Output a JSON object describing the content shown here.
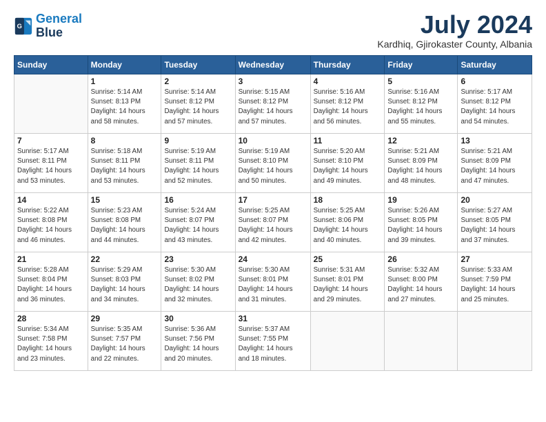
{
  "logo": {
    "line1": "General",
    "line2": "Blue"
  },
  "title": "July 2024",
  "location": "Kardhiq, Gjirokaster County, Albania",
  "weekdays": [
    "Sunday",
    "Monday",
    "Tuesday",
    "Wednesday",
    "Thursday",
    "Friday",
    "Saturday"
  ],
  "weeks": [
    [
      {
        "day": "",
        "info": ""
      },
      {
        "day": "1",
        "info": "Sunrise: 5:14 AM\nSunset: 8:13 PM\nDaylight: 14 hours\nand 58 minutes."
      },
      {
        "day": "2",
        "info": "Sunrise: 5:14 AM\nSunset: 8:12 PM\nDaylight: 14 hours\nand 57 minutes."
      },
      {
        "day": "3",
        "info": "Sunrise: 5:15 AM\nSunset: 8:12 PM\nDaylight: 14 hours\nand 57 minutes."
      },
      {
        "day": "4",
        "info": "Sunrise: 5:16 AM\nSunset: 8:12 PM\nDaylight: 14 hours\nand 56 minutes."
      },
      {
        "day": "5",
        "info": "Sunrise: 5:16 AM\nSunset: 8:12 PM\nDaylight: 14 hours\nand 55 minutes."
      },
      {
        "day": "6",
        "info": "Sunrise: 5:17 AM\nSunset: 8:12 PM\nDaylight: 14 hours\nand 54 minutes."
      }
    ],
    [
      {
        "day": "7",
        "info": "Sunrise: 5:17 AM\nSunset: 8:11 PM\nDaylight: 14 hours\nand 53 minutes."
      },
      {
        "day": "8",
        "info": "Sunrise: 5:18 AM\nSunset: 8:11 PM\nDaylight: 14 hours\nand 53 minutes."
      },
      {
        "day": "9",
        "info": "Sunrise: 5:19 AM\nSunset: 8:11 PM\nDaylight: 14 hours\nand 52 minutes."
      },
      {
        "day": "10",
        "info": "Sunrise: 5:19 AM\nSunset: 8:10 PM\nDaylight: 14 hours\nand 50 minutes."
      },
      {
        "day": "11",
        "info": "Sunrise: 5:20 AM\nSunset: 8:10 PM\nDaylight: 14 hours\nand 49 minutes."
      },
      {
        "day": "12",
        "info": "Sunrise: 5:21 AM\nSunset: 8:09 PM\nDaylight: 14 hours\nand 48 minutes."
      },
      {
        "day": "13",
        "info": "Sunrise: 5:21 AM\nSunset: 8:09 PM\nDaylight: 14 hours\nand 47 minutes."
      }
    ],
    [
      {
        "day": "14",
        "info": "Sunrise: 5:22 AM\nSunset: 8:08 PM\nDaylight: 14 hours\nand 46 minutes."
      },
      {
        "day": "15",
        "info": "Sunrise: 5:23 AM\nSunset: 8:08 PM\nDaylight: 14 hours\nand 44 minutes."
      },
      {
        "day": "16",
        "info": "Sunrise: 5:24 AM\nSunset: 8:07 PM\nDaylight: 14 hours\nand 43 minutes."
      },
      {
        "day": "17",
        "info": "Sunrise: 5:25 AM\nSunset: 8:07 PM\nDaylight: 14 hours\nand 42 minutes."
      },
      {
        "day": "18",
        "info": "Sunrise: 5:25 AM\nSunset: 8:06 PM\nDaylight: 14 hours\nand 40 minutes."
      },
      {
        "day": "19",
        "info": "Sunrise: 5:26 AM\nSunset: 8:05 PM\nDaylight: 14 hours\nand 39 minutes."
      },
      {
        "day": "20",
        "info": "Sunrise: 5:27 AM\nSunset: 8:05 PM\nDaylight: 14 hours\nand 37 minutes."
      }
    ],
    [
      {
        "day": "21",
        "info": "Sunrise: 5:28 AM\nSunset: 8:04 PM\nDaylight: 14 hours\nand 36 minutes."
      },
      {
        "day": "22",
        "info": "Sunrise: 5:29 AM\nSunset: 8:03 PM\nDaylight: 14 hours\nand 34 minutes."
      },
      {
        "day": "23",
        "info": "Sunrise: 5:30 AM\nSunset: 8:02 PM\nDaylight: 14 hours\nand 32 minutes."
      },
      {
        "day": "24",
        "info": "Sunrise: 5:30 AM\nSunset: 8:01 PM\nDaylight: 14 hours\nand 31 minutes."
      },
      {
        "day": "25",
        "info": "Sunrise: 5:31 AM\nSunset: 8:01 PM\nDaylight: 14 hours\nand 29 minutes."
      },
      {
        "day": "26",
        "info": "Sunrise: 5:32 AM\nSunset: 8:00 PM\nDaylight: 14 hours\nand 27 minutes."
      },
      {
        "day": "27",
        "info": "Sunrise: 5:33 AM\nSunset: 7:59 PM\nDaylight: 14 hours\nand 25 minutes."
      }
    ],
    [
      {
        "day": "28",
        "info": "Sunrise: 5:34 AM\nSunset: 7:58 PM\nDaylight: 14 hours\nand 23 minutes."
      },
      {
        "day": "29",
        "info": "Sunrise: 5:35 AM\nSunset: 7:57 PM\nDaylight: 14 hours\nand 22 minutes."
      },
      {
        "day": "30",
        "info": "Sunrise: 5:36 AM\nSunset: 7:56 PM\nDaylight: 14 hours\nand 20 minutes."
      },
      {
        "day": "31",
        "info": "Sunrise: 5:37 AM\nSunset: 7:55 PM\nDaylight: 14 hours\nand 18 minutes."
      },
      {
        "day": "",
        "info": ""
      },
      {
        "day": "",
        "info": ""
      },
      {
        "day": "",
        "info": ""
      }
    ]
  ]
}
